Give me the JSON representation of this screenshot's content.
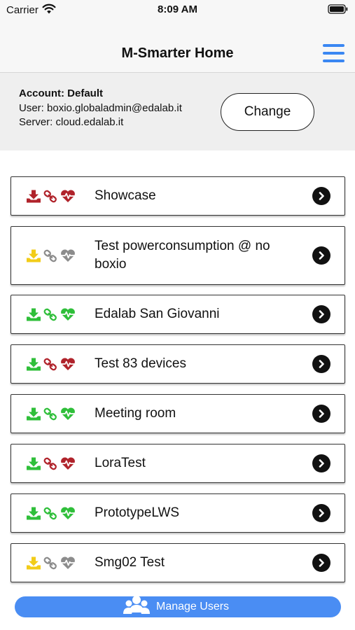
{
  "status_bar": {
    "carrier": "Carrier",
    "time": "8:09 AM",
    "wifi_icon": "wifi-icon",
    "battery_icon": "battery-icon"
  },
  "nav": {
    "title": "M-Smarter Home",
    "menu_icon": "hamburger-menu-icon",
    "accent_color": "#3a87f2"
  },
  "account": {
    "title": "Account: Default",
    "user": "User: boxio.globaladmin@edalab.it",
    "server": "Server: cloud.edalab.it",
    "change_label": "Change"
  },
  "status_colors": {
    "red": "#b0232b",
    "green": "#2fbf3a",
    "yellow": "#f2cc18",
    "gray": "#8c8c8c"
  },
  "sites": [
    {
      "label": "Showcase",
      "download": "red",
      "link": "red",
      "health": "red"
    },
    {
      "label": "Test powerconsumption @ no boxio",
      "download": "yellow",
      "link": "gray",
      "health": "gray"
    },
    {
      "label": "Edalab San Giovanni",
      "download": "green",
      "link": "green",
      "health": "green"
    },
    {
      "label": "Test 83 devices",
      "download": "green",
      "link": "red",
      "health": "red"
    },
    {
      "label": "Meeting room",
      "download": "green",
      "link": "green",
      "health": "green"
    },
    {
      "label": "LoraTest",
      "download": "green",
      "link": "red",
      "health": "red"
    },
    {
      "label": "PrototypeLWS",
      "download": "green",
      "link": "green",
      "health": "green"
    },
    {
      "label": "Smg02 Test",
      "download": "yellow",
      "link": "gray",
      "health": "gray"
    }
  ],
  "manage_users": {
    "label": "Manage Users",
    "icon": "users-icon",
    "color": "#4a8df3"
  }
}
